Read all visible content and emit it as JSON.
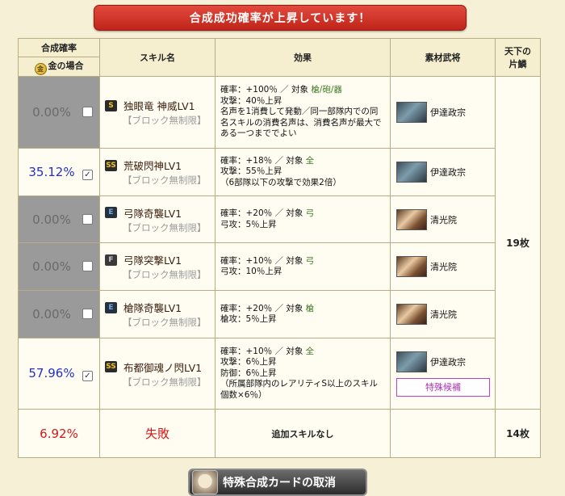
{
  "banner": "合成成功確率が上昇しています！",
  "headers": {
    "rate": "合成確率",
    "gold": "金の場合",
    "skill": "スキル名",
    "effect": "効果",
    "material": "素材武将",
    "shards_line1": "天下の",
    "shards_line2": "片鱗"
  },
  "rows": [
    {
      "rate": "0.00%",
      "checked": false,
      "rank": "S",
      "name": "独眼竜 神威LV1",
      "note": "【ブロック無制限】",
      "effect": [
        "確率：+100％ ／ 対象 ",
        "槍/砲/器",
        "攻撃：40％上昇",
        "名声を1消費して発動／同一部隊内での同名スキルの消費名声は、消費名声が最大である一つまででよい"
      ],
      "material": "伊達政宗"
    },
    {
      "rate": "35.12%",
      "checked": true,
      "rank": "SS",
      "name": "荒破閃神LV1",
      "note": "【ブロック無制限】",
      "effect": [
        "確率：+18％ ／ 対象 ",
        "全",
        "攻撃：55％上昇",
        "（6部隊以下の攻撃で効果2倍）"
      ],
      "material": "伊達政宗"
    },
    {
      "rate": "0.00%",
      "checked": false,
      "rank": "E",
      "name": "弓隊奇襲LV1",
      "note": "【ブロック無制限】",
      "effect": [
        "確率：+20％ ／ 対象 ",
        "弓",
        "弓攻：5％上昇"
      ],
      "material": "清光院"
    },
    {
      "rate": "0.00%",
      "checked": false,
      "rank": "F",
      "name": "弓隊突撃LV1",
      "note": "【ブロック無制限】",
      "effect": [
        "確率：+10％ ／ 対象 ",
        "弓",
        "弓攻：10％上昇"
      ],
      "material": "清光院"
    },
    {
      "rate": "0.00%",
      "checked": false,
      "rank": "E",
      "name": "槍隊奇襲LV1",
      "note": "【ブロック無制限】",
      "effect": [
        "確率：+20％ ／ 対象 ",
        "槍",
        "槍攻：5％上昇"
      ],
      "material": "清光院"
    },
    {
      "rate": "57.96%",
      "checked": true,
      "rank": "SS",
      "name": "布都御魂ノ閃LV1",
      "note": "【ブロック無制限】",
      "effect": [
        "確率：+10％ ／ 対象 ",
        "全",
        "攻撃：6％上昇",
        "防御：6％上昇",
        "（所属部隊内のレアリティS以上のスキル個数×6％）"
      ],
      "material": "伊達政宗",
      "special": "特殊候補"
    }
  ],
  "shards_main": "19枚",
  "fail": {
    "rate": "6.92%",
    "label": "失敗",
    "effect": "追加スキルなし",
    "shards": "14枚"
  },
  "cancel_button": "特殊合成カードの取消",
  "colors": {
    "banner_red": "#d8352a",
    "active_rate_blue": "#2230c6",
    "fail_red": "#d21a1a",
    "target_green": "#3f7a25",
    "special_magenta": "#b030b8"
  },
  "icons": {
    "gold": "gold-coin-icon",
    "checkbox": "checkbox-icon"
  }
}
